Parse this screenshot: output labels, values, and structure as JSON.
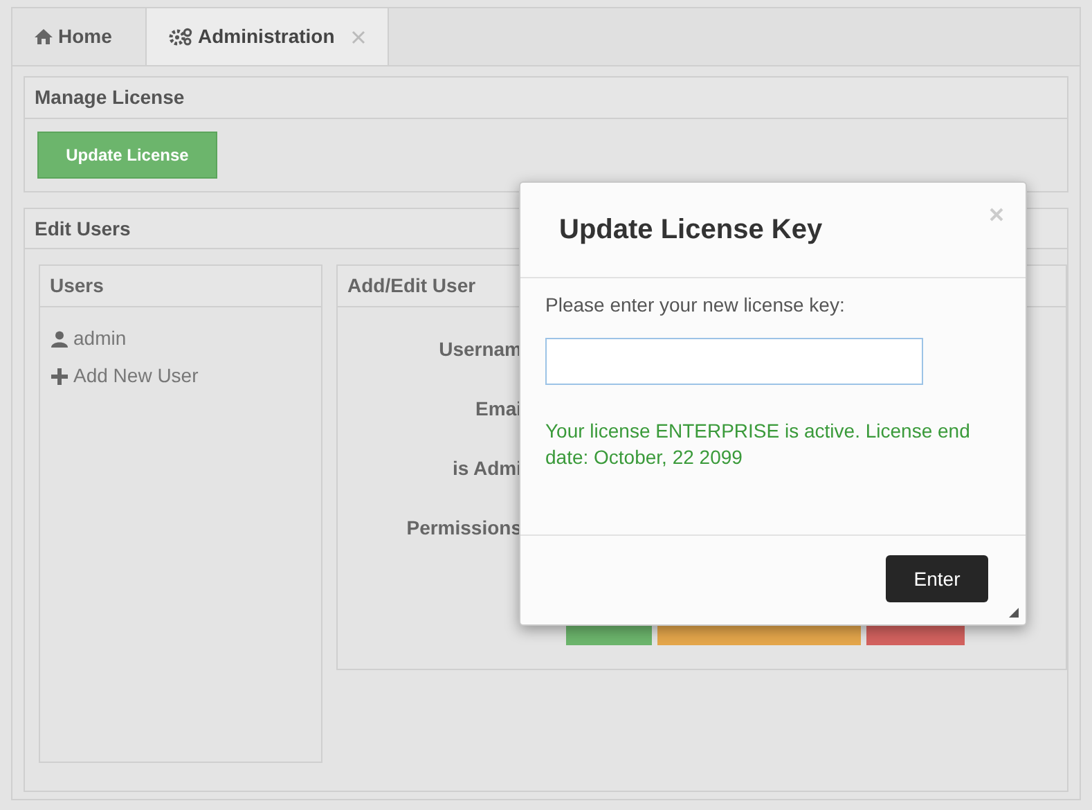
{
  "tabs": [
    {
      "label": "Home",
      "kind": "home",
      "selected": false,
      "closable": false
    },
    {
      "label": "Administration",
      "kind": "gears",
      "selected": true,
      "closable": true
    }
  ],
  "manage_license": {
    "title": "Manage License",
    "button": "Update License"
  },
  "edit_users": {
    "title": "Edit Users",
    "users_panel": {
      "title": "Users",
      "items": [
        {
          "kind": "user",
          "label": "admin"
        },
        {
          "kind": "add",
          "label": "Add New User"
        }
      ]
    },
    "edit_panel": {
      "title": "Add/Edit User",
      "labels": [
        "Usernam",
        "Emai",
        "is Admi",
        "Permissions"
      ],
      "buttons": [
        {
          "color": "#6cb56c"
        },
        {
          "color": "#e4a64b"
        },
        {
          "color": "#d3625f"
        }
      ]
    }
  },
  "dialog": {
    "title": "Update License Key",
    "prompt": "Please enter your new license key:",
    "status": "Your license ENTERPRISE is active. License end date: October, 22 2099",
    "button": "Enter"
  }
}
